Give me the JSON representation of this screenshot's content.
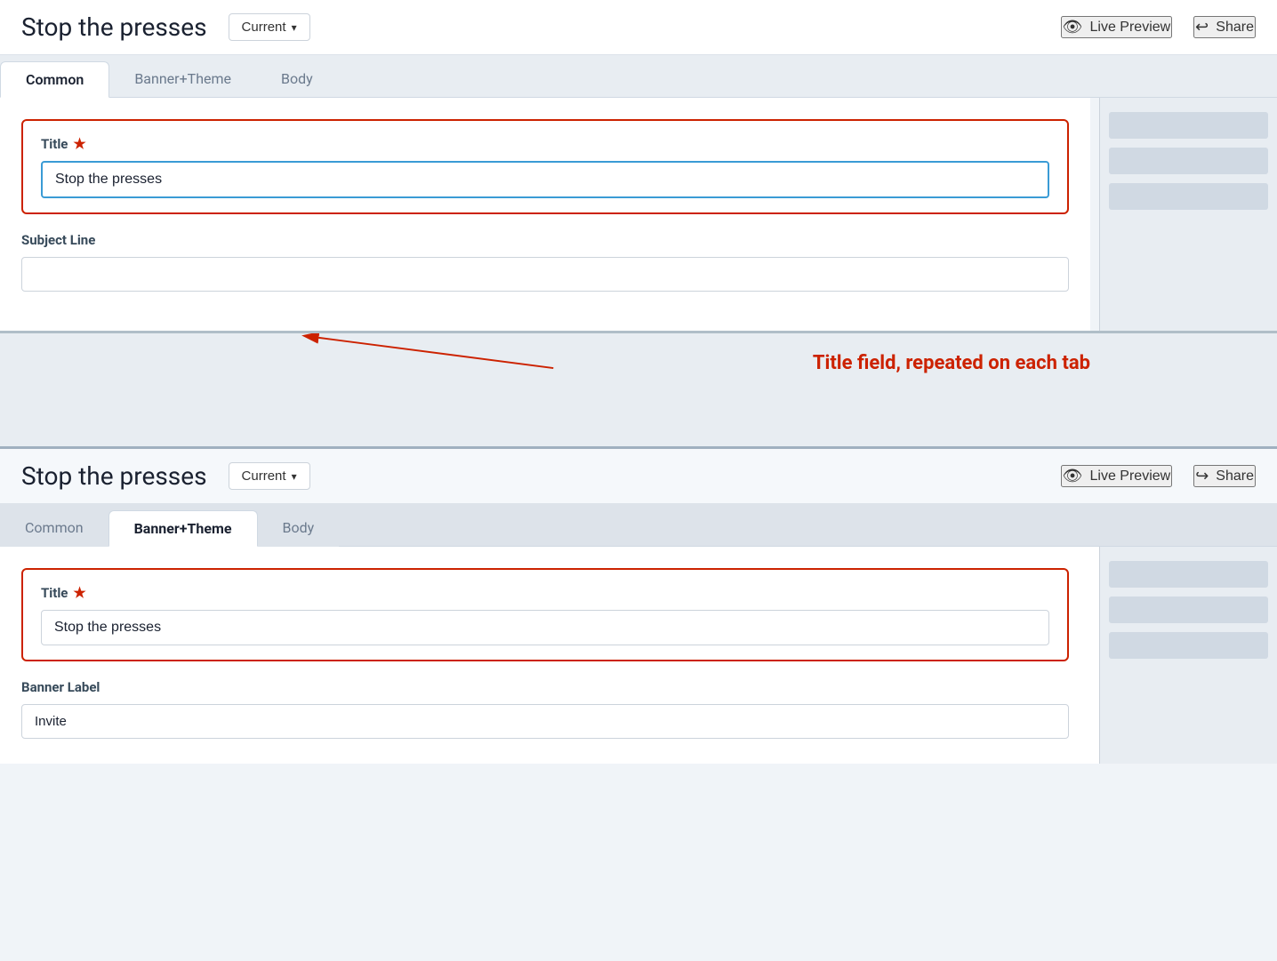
{
  "app": {
    "title": "Stop the presses"
  },
  "panel1": {
    "title": "Stop the presses",
    "version_label": "Current",
    "live_preview_label": "Live Preview",
    "share_label": "Share",
    "tabs": [
      {
        "id": "common",
        "label": "Common",
        "active": true
      },
      {
        "id": "banner-theme",
        "label": "Banner+Theme",
        "active": false
      },
      {
        "id": "body",
        "label": "Body",
        "active": false
      }
    ],
    "title_field": {
      "label": "Title",
      "required": true,
      "value": "Stop the presses",
      "placeholder": ""
    },
    "subject_field": {
      "label": "Subject Line",
      "required": false,
      "value": "",
      "placeholder": ""
    }
  },
  "annotation": {
    "text": "Title field, repeated on each tab"
  },
  "panel2": {
    "title": "Stop the presses",
    "version_label": "Current",
    "live_preview_label": "Live Preview",
    "share_label": "Share",
    "tabs": [
      {
        "id": "common",
        "label": "Common",
        "active": false
      },
      {
        "id": "banner-theme",
        "label": "Banner+Theme",
        "active": true
      },
      {
        "id": "body",
        "label": "Body",
        "active": false
      }
    ],
    "title_field": {
      "label": "Title",
      "required": true,
      "value": "Stop the presses"
    },
    "banner_label_field": {
      "label": "Banner Label",
      "value": "Invite"
    }
  },
  "icons": {
    "eye": "👁",
    "share": "↪",
    "chevron_down": "∨"
  }
}
